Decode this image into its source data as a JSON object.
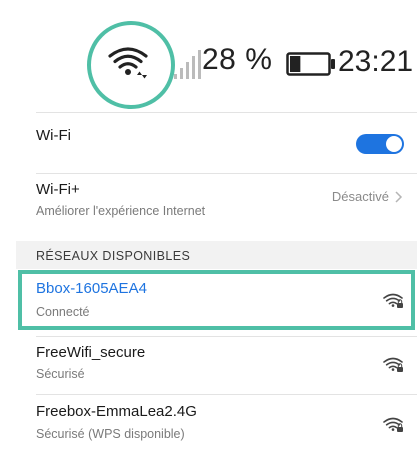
{
  "statusbar": {
    "battery_percent": "28 %",
    "time": "23:21",
    "wifi_icon": "wifi-icon",
    "signal_icon": "cellular-signal-icon",
    "battery_icon": "battery-icon",
    "battery_level": 0.28
  },
  "wifi": {
    "label": "Wi-Fi",
    "enabled": true,
    "toggle_color": "#1e74e0"
  },
  "wifi_plus": {
    "label": "Wi-Fi+",
    "description": "Améliorer l'expérience Internet",
    "status": "Désactivé"
  },
  "networks_section": {
    "header": "RÉSEAUX DISPONIBLES"
  },
  "networks": [
    {
      "name": "Bbox-1605AEA4",
      "status": "Connecté"
    },
    {
      "name": "FreeWifi_secure",
      "status": "Sécurisé"
    },
    {
      "name": "Freebox-EmmaLea2.4G",
      "status": "Sécurisé (WPS disponible)"
    }
  ],
  "colors": {
    "accent": "#1e74e0",
    "highlight": "#4fbfa6"
  }
}
